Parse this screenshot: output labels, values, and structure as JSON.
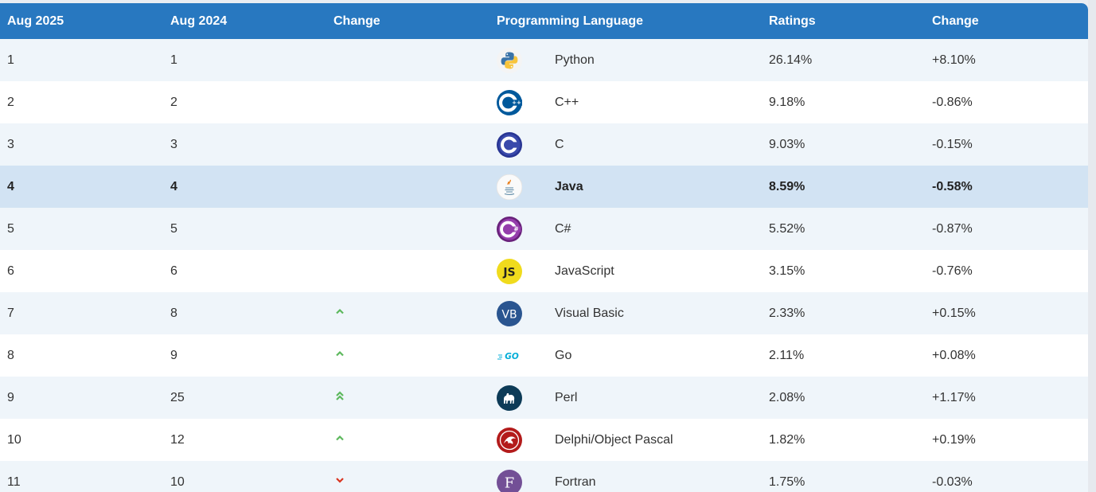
{
  "header": {
    "col_aug2025": "Aug 2025",
    "col_aug2024": "Aug 2024",
    "col_change": "Change",
    "col_language": "Programming Language",
    "col_ratings": "Ratings",
    "col_change2": "Change"
  },
  "rows": [
    {
      "aug2025": "1",
      "aug2024": "1",
      "trend": "none",
      "language": "Python",
      "logo": "python-logo-icon",
      "ratings": "26.14%",
      "change": "+8.10%"
    },
    {
      "aug2025": "2",
      "aug2024": "2",
      "trend": "none",
      "language": "C++",
      "logo": "cpp-logo-icon",
      "ratings": "9.18%",
      "change": "-0.86%"
    },
    {
      "aug2025": "3",
      "aug2024": "3",
      "trend": "none",
      "language": "C",
      "logo": "c-logo-icon",
      "ratings": "9.03%",
      "change": "-0.15%"
    },
    {
      "aug2025": "4",
      "aug2024": "4",
      "trend": "none",
      "language": "Java",
      "logo": "java-logo-icon",
      "ratings": "8.59%",
      "change": "-0.58%"
    },
    {
      "aug2025": "5",
      "aug2024": "5",
      "trend": "none",
      "language": "C#",
      "logo": "csharp-logo-icon",
      "ratings": "5.52%",
      "change": "-0.87%"
    },
    {
      "aug2025": "6",
      "aug2024": "6",
      "trend": "none",
      "language": "JavaScript",
      "logo": "javascript-logo-icon",
      "logo_text": "JS",
      "ratings": "3.15%",
      "change": "-0.76%"
    },
    {
      "aug2025": "7",
      "aug2024": "8",
      "trend": "up",
      "language": "Visual Basic",
      "logo": "visual-basic-logo-icon",
      "logo_text": "VB",
      "ratings": "2.33%",
      "change": "+0.15%"
    },
    {
      "aug2025": "8",
      "aug2024": "9",
      "trend": "up",
      "language": "Go",
      "logo": "go-logo-icon",
      "logo_text": "GO",
      "ratings": "2.11%",
      "change": "+0.08%"
    },
    {
      "aug2025": "9",
      "aug2024": "25",
      "trend": "double-up",
      "language": "Perl",
      "logo": "perl-logo-icon",
      "ratings": "2.08%",
      "change": "+1.17%"
    },
    {
      "aug2025": "10",
      "aug2024": "12",
      "trend": "up",
      "language": "Delphi/Object Pascal",
      "logo": "delphi-logo-icon",
      "ratings": "1.82%",
      "change": "+0.19%"
    },
    {
      "aug2025": "11",
      "aug2024": "10",
      "trend": "down",
      "language": "Fortran",
      "logo": "fortran-logo-icon",
      "logo_text": "F",
      "ratings": "1.75%",
      "change": "-0.03%"
    }
  ],
  "colors": {
    "header_bg": "#2878c0",
    "row_alt": "#eff5fa",
    "row_highlight": "#d2e3f3",
    "trend_up": "#5cb85c",
    "trend_down": "#d9341f"
  }
}
